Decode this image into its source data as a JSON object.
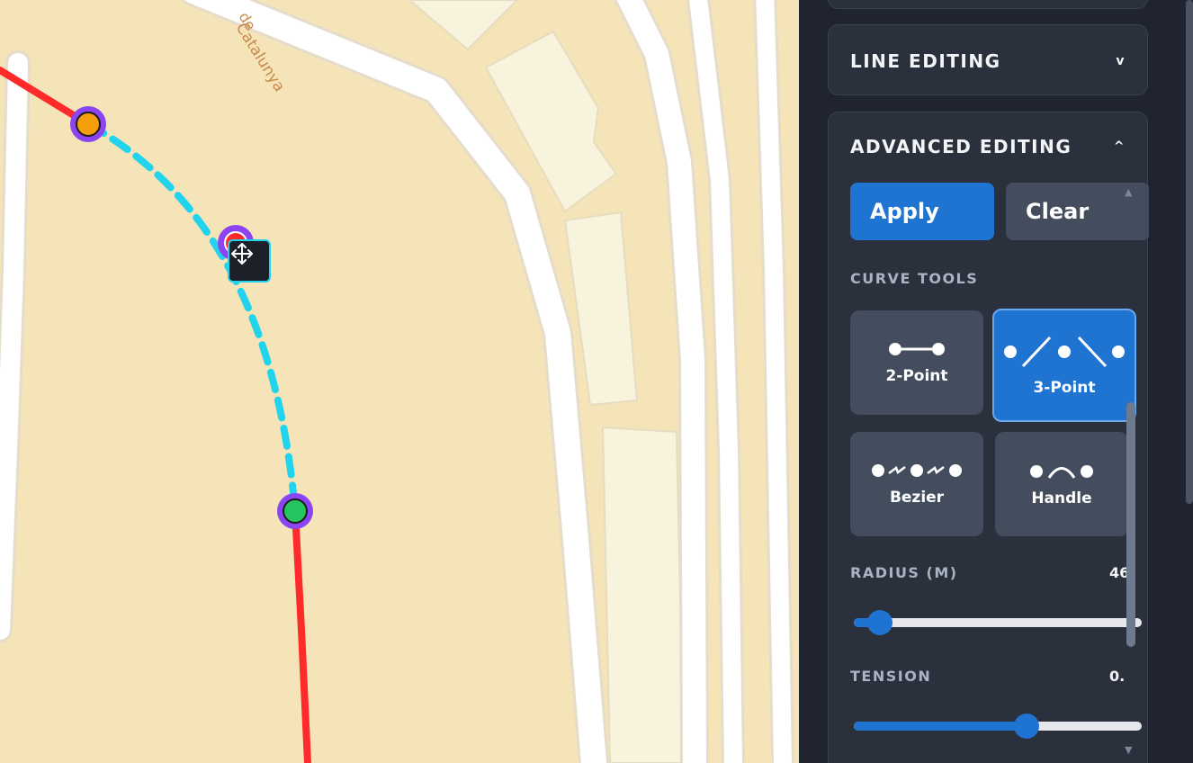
{
  "map": {
    "street_label": "Catalunya",
    "street_label_prefix": "de"
  },
  "panel": {
    "line_editing": {
      "title": "LINE EDITING",
      "chevron": "v"
    },
    "advanced_editing": {
      "title": "ADVANCED EDITING",
      "chevron": "^",
      "apply_label": "Apply",
      "clear_label": "Clear",
      "curve_tools_label": "CURVE TOOLS",
      "tools": [
        {
          "label": "2-Point",
          "selected": false
        },
        {
          "label": "3-Point",
          "selected": true
        },
        {
          "label": "Bezier",
          "selected": false
        },
        {
          "label": "Handle",
          "selected": false
        }
      ],
      "radius": {
        "label": "RADIUS (M)",
        "value_text": "46",
        "fraction": 0.09
      },
      "tension": {
        "label": "TENSION",
        "value_text": "0.",
        "fraction": 0.6
      }
    }
  },
  "colors": {
    "accent": "#2074d1",
    "route_red": "#ff2a2a",
    "route_cyan": "#22d3ee",
    "vertex_purple": "#8b44f0",
    "vertex_orange": "#f59e0b",
    "vertex_green": "#22c55e"
  },
  "icons": [
    "move-icon",
    "two-point-icon",
    "three-point-icon",
    "bezier-icon",
    "handle-icon"
  ]
}
